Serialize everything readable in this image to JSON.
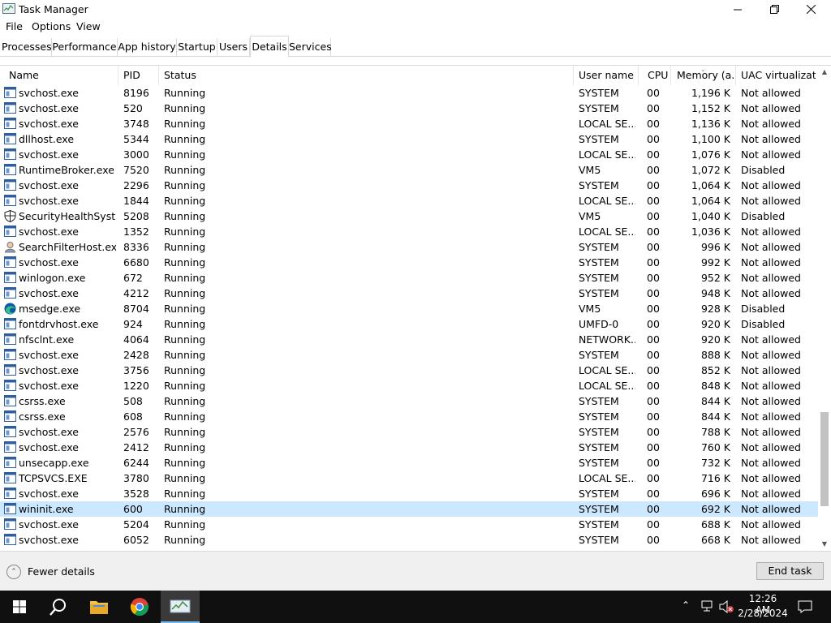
{
  "window": {
    "title": "Task Manager"
  },
  "menu": [
    "File",
    "Options",
    "View"
  ],
  "tabs": [
    "Processes",
    "Performance",
    "App history",
    "Startup",
    "Users",
    "Details",
    "Services"
  ],
  "active_tab": "Details",
  "columns": [
    "Name",
    "PID",
    "Status",
    "User name",
    "CPU",
    "Memory (a...",
    "UAC virtualizat..."
  ],
  "rows": [
    {
      "icon": "app-icon",
      "name": "svchost.exe",
      "pid": "8196",
      "status": "Running",
      "user": "SYSTEM",
      "cpu": "00",
      "mem": "1,196 K",
      "uac": "Not allowed"
    },
    {
      "icon": "app-icon",
      "name": "svchost.exe",
      "pid": "520",
      "status": "Running",
      "user": "SYSTEM",
      "cpu": "00",
      "mem": "1,152 K",
      "uac": "Not allowed"
    },
    {
      "icon": "app-icon",
      "name": "svchost.exe",
      "pid": "3748",
      "status": "Running",
      "user": "LOCAL SE...",
      "cpu": "00",
      "mem": "1,136 K",
      "uac": "Not allowed"
    },
    {
      "icon": "app-icon",
      "name": "dllhost.exe",
      "pid": "5344",
      "status": "Running",
      "user": "SYSTEM",
      "cpu": "00",
      "mem": "1,100 K",
      "uac": "Not allowed"
    },
    {
      "icon": "app-icon",
      "name": "svchost.exe",
      "pid": "3000",
      "status": "Running",
      "user": "LOCAL SE...",
      "cpu": "00",
      "mem": "1,076 K",
      "uac": "Not allowed"
    },
    {
      "icon": "app-icon",
      "name": "RuntimeBroker.exe",
      "pid": "7520",
      "status": "Running",
      "user": "VM5",
      "cpu": "00",
      "mem": "1,072 K",
      "uac": "Disabled"
    },
    {
      "icon": "app-icon",
      "name": "svchost.exe",
      "pid": "2296",
      "status": "Running",
      "user": "SYSTEM",
      "cpu": "00",
      "mem": "1,064 K",
      "uac": "Not allowed"
    },
    {
      "icon": "app-icon",
      "name": "svchost.exe",
      "pid": "1844",
      "status": "Running",
      "user": "LOCAL SE...",
      "cpu": "00",
      "mem": "1,064 K",
      "uac": "Not allowed"
    },
    {
      "icon": "shield-icon",
      "name": "SecurityHealthSystra...",
      "pid": "5208",
      "status": "Running",
      "user": "VM5",
      "cpu": "00",
      "mem": "1,040 K",
      "uac": "Disabled"
    },
    {
      "icon": "app-icon",
      "name": "svchost.exe",
      "pid": "1352",
      "status": "Running",
      "user": "LOCAL SE...",
      "cpu": "00",
      "mem": "1,036 K",
      "uac": "Not allowed"
    },
    {
      "icon": "search-filter-icon",
      "name": "SearchFilterHost.exe",
      "pid": "8336",
      "status": "Running",
      "user": "SYSTEM",
      "cpu": "00",
      "mem": "996 K",
      "uac": "Not allowed"
    },
    {
      "icon": "app-icon",
      "name": "svchost.exe",
      "pid": "6680",
      "status": "Running",
      "user": "SYSTEM",
      "cpu": "00",
      "mem": "992 K",
      "uac": "Not allowed"
    },
    {
      "icon": "app-icon",
      "name": "winlogon.exe",
      "pid": "672",
      "status": "Running",
      "user": "SYSTEM",
      "cpu": "00",
      "mem": "952 K",
      "uac": "Not allowed"
    },
    {
      "icon": "app-icon",
      "name": "svchost.exe",
      "pid": "4212",
      "status": "Running",
      "user": "SYSTEM",
      "cpu": "00",
      "mem": "948 K",
      "uac": "Not allowed"
    },
    {
      "icon": "edge-icon",
      "name": "msedge.exe",
      "pid": "8704",
      "status": "Running",
      "user": "VM5",
      "cpu": "00",
      "mem": "928 K",
      "uac": "Disabled"
    },
    {
      "icon": "app-icon",
      "name": "fontdrvhost.exe",
      "pid": "924",
      "status": "Running",
      "user": "UMFD-0",
      "cpu": "00",
      "mem": "920 K",
      "uac": "Disabled"
    },
    {
      "icon": "app-icon",
      "name": "nfsclnt.exe",
      "pid": "4064",
      "status": "Running",
      "user": "NETWORK...",
      "cpu": "00",
      "mem": "920 K",
      "uac": "Not allowed"
    },
    {
      "icon": "app-icon",
      "name": "svchost.exe",
      "pid": "2428",
      "status": "Running",
      "user": "SYSTEM",
      "cpu": "00",
      "mem": "888 K",
      "uac": "Not allowed"
    },
    {
      "icon": "app-icon",
      "name": "svchost.exe",
      "pid": "3756",
      "status": "Running",
      "user": "LOCAL SE...",
      "cpu": "00",
      "mem": "852 K",
      "uac": "Not allowed"
    },
    {
      "icon": "app-icon",
      "name": "svchost.exe",
      "pid": "1220",
      "status": "Running",
      "user": "LOCAL SE...",
      "cpu": "00",
      "mem": "848 K",
      "uac": "Not allowed"
    },
    {
      "icon": "app-icon",
      "name": "csrss.exe",
      "pid": "508",
      "status": "Running",
      "user": "SYSTEM",
      "cpu": "00",
      "mem": "844 K",
      "uac": "Not allowed"
    },
    {
      "icon": "app-icon",
      "name": "csrss.exe",
      "pid": "608",
      "status": "Running",
      "user": "SYSTEM",
      "cpu": "00",
      "mem": "844 K",
      "uac": "Not allowed"
    },
    {
      "icon": "app-icon",
      "name": "svchost.exe",
      "pid": "2576",
      "status": "Running",
      "user": "SYSTEM",
      "cpu": "00",
      "mem": "788 K",
      "uac": "Not allowed"
    },
    {
      "icon": "app-icon",
      "name": "svchost.exe",
      "pid": "2412",
      "status": "Running",
      "user": "SYSTEM",
      "cpu": "00",
      "mem": "760 K",
      "uac": "Not allowed"
    },
    {
      "icon": "app-icon",
      "name": "unsecapp.exe",
      "pid": "6244",
      "status": "Running",
      "user": "SYSTEM",
      "cpu": "00",
      "mem": "732 K",
      "uac": "Not allowed"
    },
    {
      "icon": "app-icon",
      "name": "TCPSVCS.EXE",
      "pid": "3780",
      "status": "Running",
      "user": "LOCAL SE...",
      "cpu": "00",
      "mem": "716 K",
      "uac": "Not allowed"
    },
    {
      "icon": "app-icon",
      "name": "svchost.exe",
      "pid": "3528",
      "status": "Running",
      "user": "SYSTEM",
      "cpu": "00",
      "mem": "696 K",
      "uac": "Not allowed"
    },
    {
      "icon": "app-icon",
      "name": "wininit.exe",
      "pid": "600",
      "status": "Running",
      "user": "SYSTEM",
      "cpu": "00",
      "mem": "692 K",
      "uac": "Not allowed",
      "selected": true
    },
    {
      "icon": "app-icon",
      "name": "svchost.exe",
      "pid": "5204",
      "status": "Running",
      "user": "SYSTEM",
      "cpu": "00",
      "mem": "688 K",
      "uac": "Not allowed"
    },
    {
      "icon": "app-icon",
      "name": "svchost.exe",
      "pid": "6052",
      "status": "Running",
      "user": "SYSTEM",
      "cpu": "00",
      "mem": "668 K",
      "uac": "Not allowed"
    }
  ],
  "footer": {
    "fewer_details": "Fewer details",
    "end_task": "End task"
  },
  "taskbar": {
    "apps": [
      "start-icon",
      "search-icon",
      "file-explorer-icon",
      "chrome-icon",
      "task-manager-icon"
    ],
    "time": "12:26 AM",
    "date": "2/28/2024"
  },
  "colors": {
    "selected_row": "#cce8ff",
    "taskbar": "#101010",
    "accent": "#76b9ed"
  }
}
